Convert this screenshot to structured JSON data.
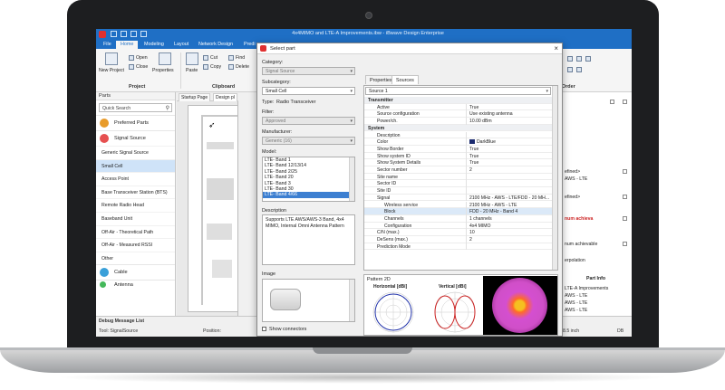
{
  "app": {
    "title": "4x4MIMO and LTE-A Improvements.ibw - iBwave Design Enterprise",
    "tabs": [
      "File",
      "Home",
      "Modeling",
      "Layout",
      "Network Design",
      "Predi"
    ],
    "active_tab": "Home"
  },
  "ribbon": {
    "new_project": "New Project",
    "open": "Open",
    "close": "Close",
    "properties": "Properties",
    "paste": "Paste",
    "cut": "Cut",
    "copy": "Copy",
    "find": "Find",
    "delete": "Delete",
    "group_project": "Project",
    "group_clipboard": "Clipboard",
    "group_order": "Order"
  },
  "parts_panel": {
    "title": "Parts",
    "search_placeholder": "Quick Search",
    "categories": {
      "preferred": "Preferred Parts",
      "signal_source": "Signal Source",
      "cable": "Cable",
      "antenna": "Antenna"
    },
    "items": [
      "Generic Signal Source",
      "Small Cell",
      "Access Point",
      "Base Transceiver Station (BTS)",
      "Remote Radio Head",
      "Baseband Unit",
      "Off-Air - Theoretical Path",
      "Off-Air - Measured RSSI",
      "Other"
    ],
    "selected_item": "Small Cell",
    "debug_tab": "Debug Message List"
  },
  "canvas": {
    "tab_startup": "Startup Page",
    "tab_design": "Design pl"
  },
  "status": {
    "tool": "Tool: SignalSource",
    "position": "Position:",
    "zoom": "8.5 inch",
    "db": "DB"
  },
  "right_panel": {
    "rows": [
      "efined>",
      "AWS - LTE",
      "efined>",
      "num achieva",
      "num achievable",
      "erpolation",
      "LTE-A Improvements",
      "AWS - LTE",
      "AWS - LTE",
      "AWS - LTE"
    ],
    "part_info": "Part Info"
  },
  "dialog": {
    "title": "Select part",
    "category_label": "Category:",
    "category_value": "Signal Source",
    "subcategory_label": "Subcategory:",
    "subcategory_value": "Small Cell",
    "type_label": "Type:",
    "type_value": "Radio Transceiver",
    "filter_label": "Filter:",
    "filter_value": "Approved",
    "manufacturer_label": "Manufacturer:",
    "manufacturer_value": "Generic (16)",
    "model_label": "Model:",
    "models": [
      "LTE- Band 1",
      "LTE- Band 12/13/14",
      "LTE- Band 2/25",
      "LTE- Band 20",
      "LTE- Band 3",
      "LTE- Band 30",
      "LTE- Band 4/66"
    ],
    "selected_model": "LTE- Band 4/66",
    "description_label": "Description",
    "description": "Supports LTE AWS/AWS-3 Band, 4x4 MIMO, Internal Omni Antenna Pattern",
    "image_label": "Image",
    "show_connectors": "Show connectors",
    "ok": "OK",
    "cancel": "Cancel",
    "tab_properties": "Properties",
    "tab_sources": "Sources",
    "source_select": "Source 1",
    "pattern_label": "Pattern 2D",
    "horizontal_label": "Horizontal [dBi]",
    "vertical_label": "Vertical [dBi]",
    "property_rows": [
      {
        "key": "Transmitter",
        "value": "",
        "kind": "cat"
      },
      {
        "key": "Active",
        "value": "True",
        "kind": "row"
      },
      {
        "key": "Source configuration",
        "value": "Use existing antenna",
        "kind": "row"
      },
      {
        "key": "Power/ch.",
        "value": "10.00 dBm",
        "kind": "row"
      },
      {
        "key": "System",
        "value": "",
        "kind": "cat"
      },
      {
        "key": "Description",
        "value": "",
        "kind": "row"
      },
      {
        "key": "Color",
        "value": "DarkBlue",
        "kind": "color"
      },
      {
        "key": "Show Border",
        "value": "True",
        "kind": "row"
      },
      {
        "key": "Show system ID",
        "value": "True",
        "kind": "row"
      },
      {
        "key": "Show System Details",
        "value": "True",
        "kind": "row"
      },
      {
        "key": "Sector number",
        "value": "2",
        "kind": "row"
      },
      {
        "key": "Site name",
        "value": "",
        "kind": "row"
      },
      {
        "key": "Sector ID",
        "value": "",
        "kind": "row"
      },
      {
        "key": "Site ID",
        "value": "",
        "kind": "row"
      },
      {
        "key": "Signal",
        "value": "2100 MHz - AWS - LTE/FDD - 20 MH...",
        "kind": "row"
      },
      {
        "key": "Wireless service",
        "value": "2100 MHz - AWS - LTE",
        "kind": "sub"
      },
      {
        "key": "Block",
        "value": "FDD - 20 MHz - Band 4",
        "kind": "subsel"
      },
      {
        "key": "Channels",
        "value": "1 channels",
        "kind": "sub"
      },
      {
        "key": "Configuration",
        "value": "4x4 MIMO",
        "kind": "sub"
      },
      {
        "key": "C/N (max.)",
        "value": "10",
        "kind": "row"
      },
      {
        "key": "DeSens (max.)",
        "value": "2",
        "kind": "row"
      },
      {
        "key": "Prediction Mode",
        "value": "",
        "kind": "row"
      }
    ]
  },
  "colors": {
    "titlebar": "#1f6fc5",
    "selection": "#3c7fd1",
    "heatmap_outer": "#d04fc8"
  },
  "icons": [
    "app-logo-icon",
    "save-icon",
    "undo-icon",
    "close-icon",
    "chevron-down-icon",
    "search-icon",
    "pin-icon",
    "radio-icon",
    "cable-icon",
    "antenna-icon"
  ]
}
